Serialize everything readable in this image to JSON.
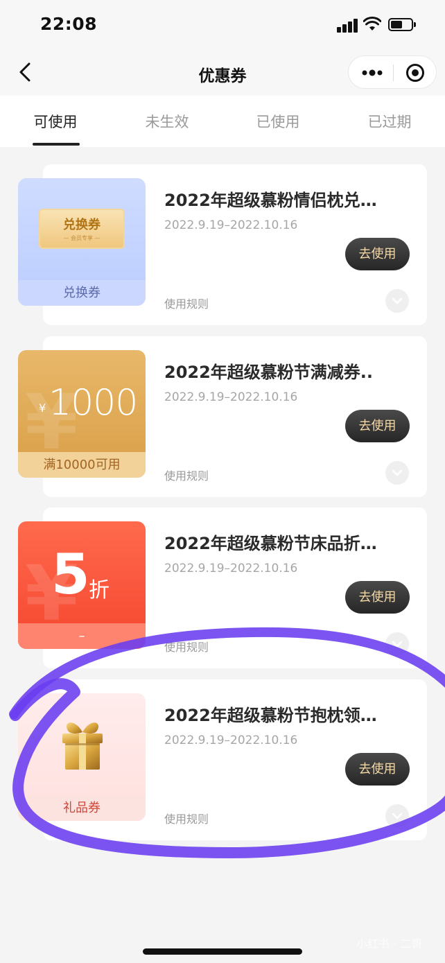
{
  "status_bar": {
    "time": "22:08"
  },
  "nav": {
    "title": "优惠券",
    "back_icon": "back-chevron-icon",
    "more_icon": "more-dots-icon",
    "close_icon": "target-circle-icon"
  },
  "tabs": [
    {
      "label": "可使用",
      "active": true
    },
    {
      "label": "未生效",
      "active": false
    },
    {
      "label": "已使用",
      "active": false
    },
    {
      "label": "已过期",
      "active": false
    }
  ],
  "coupons": [
    {
      "title": "2022年超级慕粉情侣枕兑…",
      "date": "2022.9.19–2022.10.16",
      "button": "去使用",
      "rules": "使用规则",
      "thumb_label": "兑换券",
      "ticket_main": "兑换券",
      "ticket_sub": "— 会员专享 —"
    },
    {
      "title": "2022年超级慕粉节满减券..",
      "date": "2022.9.19–2022.10.16",
      "button": "去使用",
      "rules": "使用规则",
      "thumb_label": "满10000可用",
      "currency": "¥",
      "amount": "1000"
    },
    {
      "title": "2022年超级慕粉节床品折…",
      "date": "2022.9.19–2022.10.16",
      "button": "去使用",
      "rules": "使用规则",
      "thumb_label": "–",
      "discount_num": "5",
      "discount_unit": "折"
    },
    {
      "title": "2022年超级慕粉节抱枕领…",
      "date": "2022.9.19–2022.10.16",
      "button": "去使用",
      "rules": "使用规则",
      "thumb_label": "礼品券",
      "thumb_icon": "gift-box-icon"
    }
  ],
  "annotation": {
    "color": "#6a3cf0"
  },
  "watermark": "小红书 · 二哥",
  "colors": {
    "button_bg": "#333333",
    "button_text": "#f4d9a8",
    "discount_red": "#f5462f",
    "cash_gold": "#dca14b",
    "exchange_blue": "#c4d4ff"
  }
}
